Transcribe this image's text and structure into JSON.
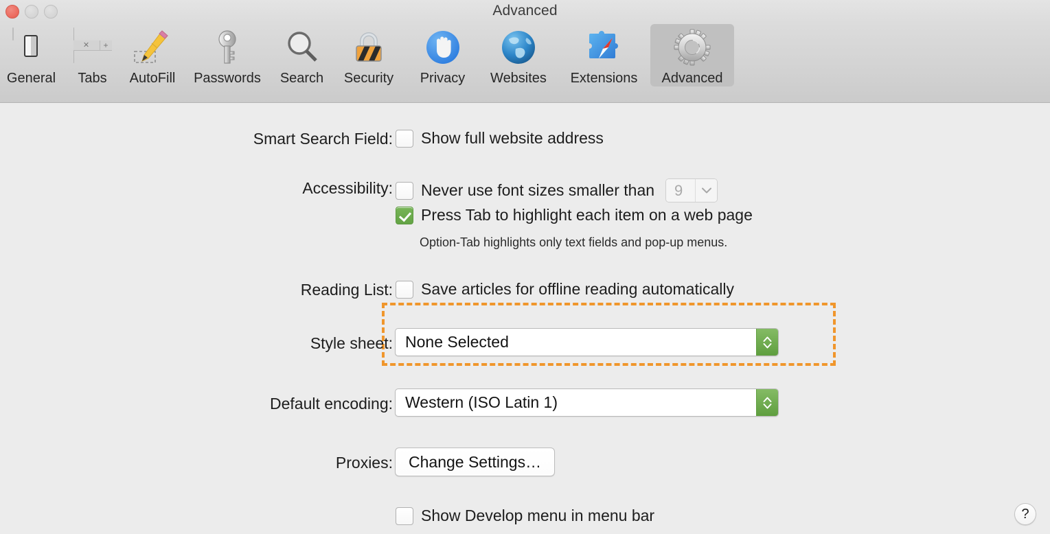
{
  "window": {
    "title": "Advanced",
    "controls": {
      "close": "close-button",
      "minimize": "minimize-button",
      "zoom": "zoom-button"
    }
  },
  "toolbar": {
    "items": [
      {
        "label": "General",
        "icon": "general-switch-icon",
        "selected": false
      },
      {
        "label": "Tabs",
        "icon": "tabs-icon",
        "selected": false
      },
      {
        "label": "AutoFill",
        "icon": "autofill-pencil-icon",
        "selected": false
      },
      {
        "label": "Passwords",
        "icon": "passwords-key-icon",
        "selected": false
      },
      {
        "label": "Search",
        "icon": "search-magnifier-icon",
        "selected": false
      },
      {
        "label": "Security",
        "icon": "security-padlock-icon",
        "selected": false
      },
      {
        "label": "Privacy",
        "icon": "privacy-hand-icon",
        "selected": false
      },
      {
        "label": "Websites",
        "icon": "websites-globe-icon",
        "selected": false
      },
      {
        "label": "Extensions",
        "icon": "extensions-puzzle-icon",
        "selected": false
      },
      {
        "label": "Advanced",
        "icon": "advanced-gear-icon",
        "selected": true
      }
    ]
  },
  "settings": {
    "smart_search": {
      "label": "Smart Search Field:",
      "checkbox_label": "Show full website address",
      "checked": false
    },
    "accessibility": {
      "label": "Accessibility:",
      "font_size_label": "Never use font sizes smaller than",
      "font_size_checked": false,
      "font_size_value": "9",
      "font_size_enabled": false,
      "tab_highlight_label": "Press Tab to highlight each item on a web page",
      "tab_highlight_checked": true,
      "tab_highlight_hint": "Option-Tab highlights only text fields and pop-up menus."
    },
    "reading_list": {
      "label": "Reading List:",
      "checkbox_label": "Save articles for offline reading automatically",
      "checked": false
    },
    "style_sheet": {
      "label": "Style sheet:",
      "value": "None Selected"
    },
    "default_encoding": {
      "label": "Default encoding:",
      "value": "Western (ISO Latin 1)"
    },
    "proxies": {
      "label": "Proxies:",
      "button_label": "Change Settings…"
    },
    "develop_menu": {
      "checkbox_label": "Show Develop menu in menu bar",
      "checked": false
    }
  },
  "help": {
    "glyph": "?"
  },
  "colors": {
    "highlight_border": "#f0962c",
    "checkbox_checked": "#6aab4c",
    "stepper_green": "#6ea84d",
    "toolbar_selected": "#c0c0c0",
    "content_bg": "#ececec"
  }
}
